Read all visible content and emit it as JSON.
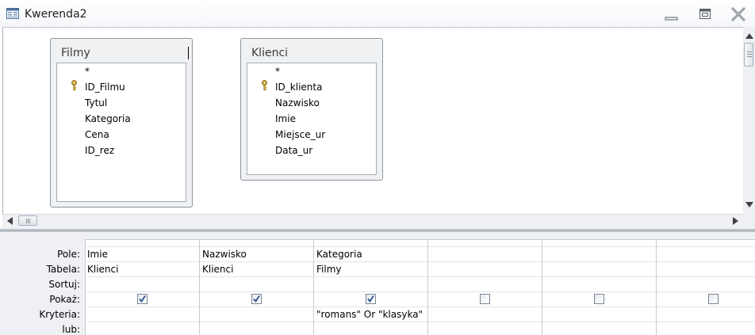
{
  "window": {
    "title": "Kwerenda2"
  },
  "tables": [
    {
      "name": "Filmy",
      "fields": [
        {
          "name": "*",
          "key": false
        },
        {
          "name": "ID_Filmu",
          "key": true
        },
        {
          "name": "Tytul",
          "key": false
        },
        {
          "name": "Kategoria",
          "key": false
        },
        {
          "name": "Cena",
          "key": false
        },
        {
          "name": "ID_rez",
          "key": false
        }
      ]
    },
    {
      "name": "Klienci",
      "fields": [
        {
          "name": "*",
          "key": false
        },
        {
          "name": "ID_klienta",
          "key": true
        },
        {
          "name": "Nazwisko",
          "key": false
        },
        {
          "name": "Imie",
          "key": false
        },
        {
          "name": "Miejsce_ur",
          "key": false
        },
        {
          "name": "Data_ur",
          "key": false
        }
      ]
    }
  ],
  "grid": {
    "row_labels": {
      "field": "Pole:",
      "table": "Tabela:",
      "sort": "Sortuj:",
      "show": "Pokaż:",
      "criteria": "Kryteria:",
      "or": "lub:"
    },
    "columns": [
      {
        "field": "Imie",
        "table": "Klienci",
        "sort": "",
        "show": true,
        "criteria": "",
        "or": ""
      },
      {
        "field": "Nazwisko",
        "table": "Klienci",
        "sort": "",
        "show": true,
        "criteria": "",
        "or": ""
      },
      {
        "field": "Kategoria",
        "table": "Filmy",
        "sort": "",
        "show": true,
        "criteria": "\"romans\" Or \"klasyka\"",
        "or": ""
      },
      {
        "field": "",
        "table": "",
        "sort": "",
        "show": false,
        "criteria": "",
        "or": ""
      },
      {
        "field": "",
        "table": "",
        "sort": "",
        "show": false,
        "criteria": "",
        "or": ""
      },
      {
        "field": "",
        "table": "",
        "sort": "",
        "show": false,
        "criteria": "",
        "or": ""
      }
    ]
  },
  "colors": {
    "pane_bg": "#eef0f3",
    "table_box_bg": "#f0f1f3",
    "checkmark": "#2b4f8c",
    "key_icon": "#c9a227"
  }
}
